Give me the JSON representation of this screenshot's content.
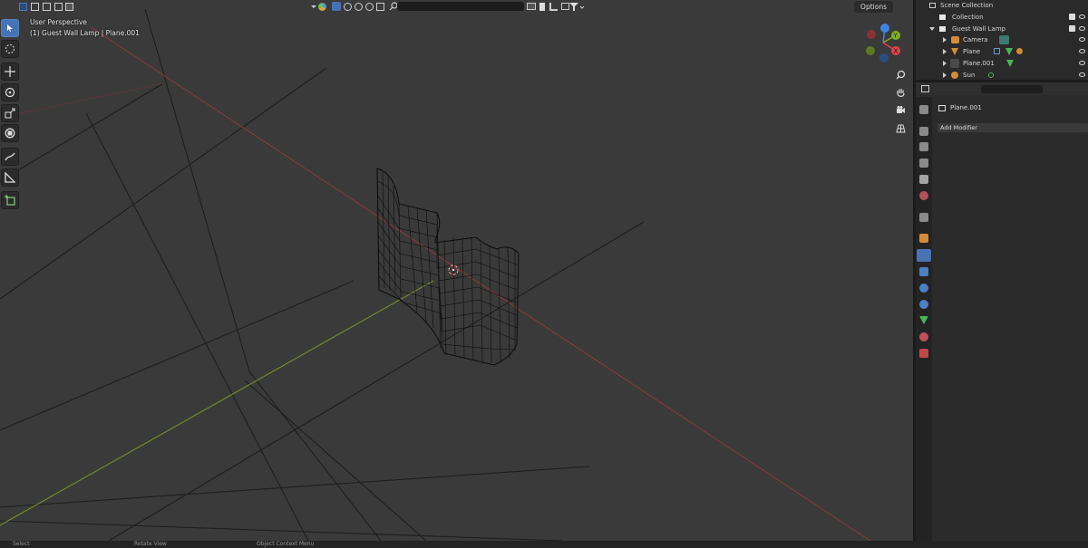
{
  "viewport": {
    "view_name": "User Perspective",
    "object_context": "(1) Guest Wall Lamp | Plane.001",
    "options_label": "Options",
    "search_placeholder": ""
  },
  "gizmo": {
    "axis_y": "Y",
    "axis_x": "X"
  },
  "outliner": {
    "rows": [
      {
        "label": "Scene Collection"
      },
      {
        "label": "Collection"
      },
      {
        "label": "Guest Wall Lamp"
      },
      {
        "label": "Camera"
      },
      {
        "label": "Plane"
      },
      {
        "label": "Plane.001"
      },
      {
        "label": "Sun"
      }
    ]
  },
  "properties": {
    "object_name": "Plane.001",
    "add_modifier_label": "Add Modifier"
  },
  "status_bar": {
    "select": "Select",
    "rotate": "Rotate View",
    "context": "Object Context Menu"
  },
  "colors": {
    "accent": "#4772b3",
    "axis_x": "#e0444a",
    "axis_y": "#7fb025",
    "axis_z": "#3f85e0"
  }
}
